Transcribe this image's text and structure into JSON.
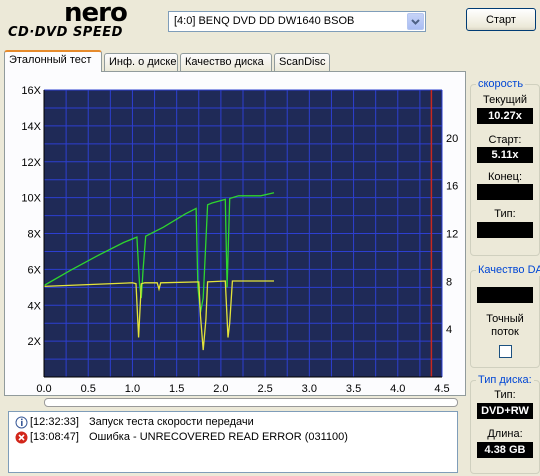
{
  "header": {
    "logo_brand": "nero",
    "logo_product": "CD·DVD SPEED",
    "drive": "[4:0]  BENQ DVD DD DW1640 BSOB",
    "start_label": "Старт"
  },
  "tabs": [
    {
      "label": "Эталонный тест",
      "active": true
    },
    {
      "label": "Инф. о диске",
      "active": false
    },
    {
      "label": "Качество диска",
      "active": false
    },
    {
      "label": "ScanDisc",
      "active": false
    }
  ],
  "speed_panel": {
    "title": "скорость",
    "current_label": "Текущий",
    "current_value": "10.27x",
    "start_label": "Старт:",
    "start_value": "5.11x",
    "end_label": "Конец:",
    "end_value": "",
    "type_label": "Тип:",
    "type_value": ""
  },
  "quality_panel": {
    "title": "Качество DA",
    "value": "",
    "accurate_label_1": "Точный",
    "accurate_label_2": "поток",
    "accurate_checked": false
  },
  "disc_panel": {
    "title": "Тип диска:",
    "type_label": "Тип:",
    "type_value": "DVD+RW",
    "length_label": "Длина:",
    "length_value": "4.38 GB"
  },
  "log": [
    {
      "icon": "info-icon",
      "time": "[12:32:33]",
      "text": "Запуск теста скорости передачи"
    },
    {
      "icon": "error-icon",
      "time": "[13:08:47]",
      "text": "Ошибка - UNRECOVERED READ ERROR (031100)"
    }
  ],
  "colors": {
    "plot_bg": "#1f2a57",
    "grid": "#2d3fd0",
    "speed_line": "#2ed52e",
    "seek_line": "#e3e33a",
    "end_marker": "#c8281e",
    "accent_title": "#0046d5"
  },
  "chart_data": {
    "type": "line",
    "x_ticks": [
      "0.0",
      "0.5",
      "1.0",
      "1.5",
      "2.0",
      "2.5",
      "3.0",
      "3.5",
      "4.0",
      "4.5"
    ],
    "y_left_ticks": [
      "2X",
      "4X",
      "6X",
      "8X",
      "10X",
      "12X",
      "14X",
      "16X"
    ],
    "y_right_ticks": [
      "4",
      "8",
      "12",
      "16",
      "20"
    ],
    "xlim": [
      0,
      4.5
    ],
    "ylim_left": [
      0,
      16
    ],
    "ylim_right": [
      0,
      24
    ],
    "end_marker_x": 4.38,
    "series": [
      {
        "color": "speed",
        "x": [
          0.0,
          0.3,
          0.6,
          0.9,
          1.05,
          1.08,
          1.1,
          1.12,
          1.15,
          1.35,
          1.6,
          1.72,
          1.74,
          1.77,
          1.8,
          1.85,
          1.9,
          2.05,
          2.07,
          2.1,
          2.2,
          2.45,
          2.6
        ],
        "y": [
          5.1,
          5.95,
          6.75,
          7.5,
          7.8,
          5.2,
          4.4,
          6.0,
          7.85,
          8.35,
          9.1,
          9.4,
          5.0,
          3.6,
          4.4,
          9.6,
          9.7,
          9.9,
          5.0,
          9.95,
          10.1,
          10.1,
          10.27
        ]
      },
      {
        "color": "seek",
        "x": [
          0.0,
          1.0,
          1.04,
          1.07,
          1.1,
          1.14,
          1.28,
          1.3,
          1.32,
          1.75,
          1.77,
          1.8,
          1.83,
          1.85,
          2.05,
          2.08,
          2.1,
          2.13,
          2.6
        ],
        "y": [
          5.05,
          5.25,
          5.2,
          2.2,
          5.2,
          5.25,
          5.25,
          4.9,
          5.25,
          5.3,
          3.4,
          1.5,
          3.2,
          5.3,
          5.35,
          2.2,
          3.0,
          5.35,
          5.35
        ]
      }
    ]
  }
}
